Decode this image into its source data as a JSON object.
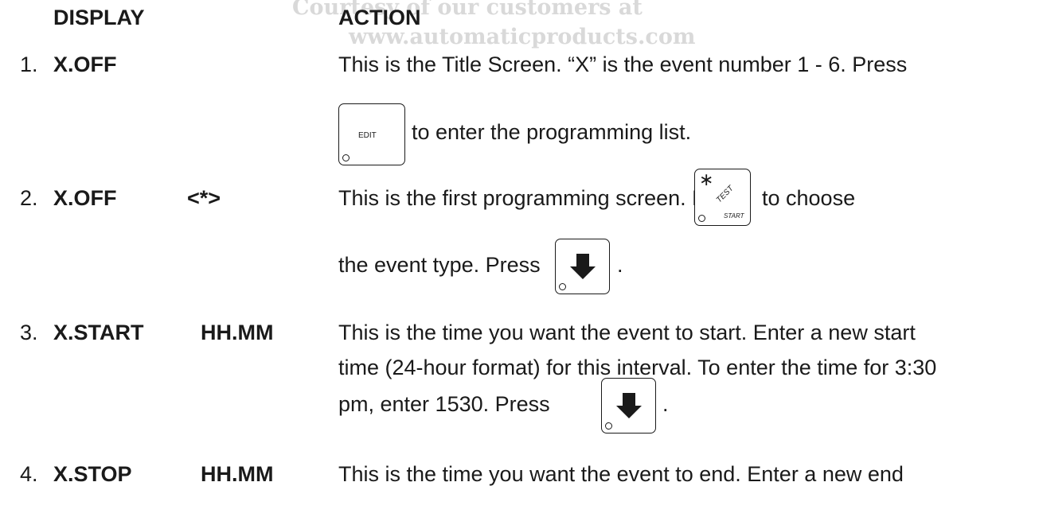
{
  "watermark": {
    "line1": "Courtesy of our customers at",
    "line2": "www.automaticproducts.com"
  },
  "header": {
    "display": "DISPLAY",
    "action": "ACTION"
  },
  "steps": [
    {
      "num": "1.",
      "display": "X.OFF",
      "display2": "",
      "lines": [
        "This is the Title Screen. “X” is the event number 1 - 6. Press",
        "to enter the programming list."
      ]
    },
    {
      "num": "2.",
      "display": "X.OFF",
      "display2": "<*>",
      "lines": [
        "This is the first programming screen. Press",
        "to choose",
        "the event type. Press",
        "."
      ]
    },
    {
      "num": "3.",
      "display": "X.START",
      "display2": "HH.MM",
      "lines": [
        "This is the time you want the event to start.  Enter a new start",
        "time (24-hour format) for this interval. To enter the time for 3:30",
        "pm, enter 1530. Press",
        "."
      ]
    },
    {
      "num": "4.",
      "display": "X.STOP",
      "display2": "HH.MM",
      "lines": [
        "This is the time you want the event to end.  Enter a new end"
      ]
    }
  ],
  "keys": {
    "edit": "EDIT",
    "test": "TEST",
    "start": "START",
    "star": "∗"
  },
  "icons": {
    "down_arrow": "down-arrow-icon"
  }
}
